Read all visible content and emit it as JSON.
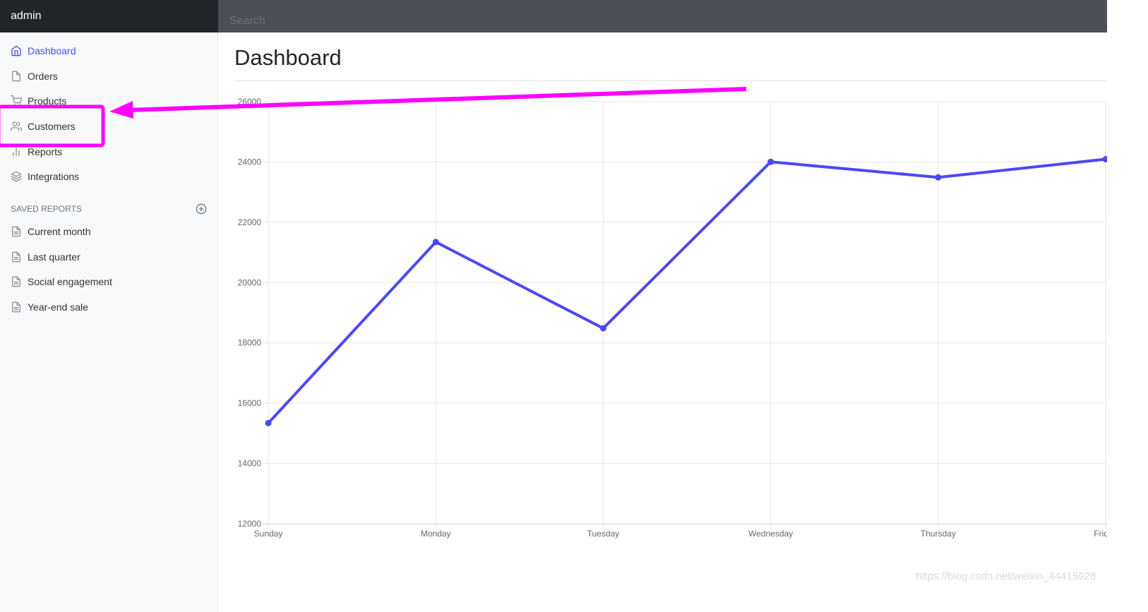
{
  "header": {
    "brand": "admin",
    "search_placeholder": "Search"
  },
  "sidebar": {
    "items": [
      {
        "label": "Dashboard",
        "icon": "home-icon",
        "active": true
      },
      {
        "label": "Orders",
        "icon": "file-icon",
        "active": false
      },
      {
        "label": "Products",
        "icon": "shopping-cart-icon",
        "active": false
      },
      {
        "label": "Customers",
        "icon": "users-icon",
        "active": false
      },
      {
        "label": "Reports",
        "icon": "bar-chart-icon",
        "active": false
      },
      {
        "label": "Integrations",
        "icon": "layers-icon",
        "active": false
      }
    ],
    "saved_reports_heading": "Saved reports",
    "saved_reports_add_icon": "plus-circle-icon",
    "saved_reports": [
      {
        "label": "Current month",
        "icon": "file-text-icon"
      },
      {
        "label": "Last quarter",
        "icon": "file-text-icon"
      },
      {
        "label": "Social engagement",
        "icon": "file-text-icon"
      },
      {
        "label": "Year-end sale",
        "icon": "file-text-icon"
      }
    ]
  },
  "main": {
    "title": "Dashboard"
  },
  "annotation": {
    "color": "#ff00ff",
    "target": "Customers"
  },
  "watermark": "https://blog.csdn.net/weixin_44415928",
  "colors": {
    "accent": "#4c4cf0",
    "line": "#4b49f5",
    "topbar_dark": "#212529",
    "search_bg": "#4b4f56"
  },
  "chart_data": {
    "type": "line",
    "title": "",
    "xlabel": "",
    "ylabel": "",
    "categories": [
      "Sunday",
      "Monday",
      "Tuesday",
      "Wednesday",
      "Thursday",
      "Friday"
    ],
    "series": [
      {
        "name": "",
        "values": [
          15339,
          21345,
          18483,
          24003,
          23489,
          24092
        ],
        "color": "#4b49f5"
      }
    ],
    "ylim": [
      12000,
      26000
    ],
    "yticks": [
      12000,
      14000,
      16000,
      18000,
      20000,
      22000,
      24000,
      26000
    ],
    "grid": true,
    "legend": "none"
  }
}
